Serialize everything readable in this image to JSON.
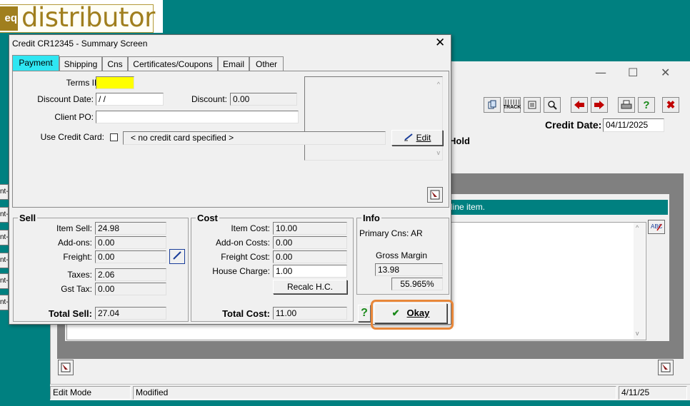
{
  "logo": {
    "badge": "eq",
    "text": "distributor"
  },
  "background_window": {
    "minimize": "—",
    "maximize": "☐",
    "close": "✕",
    "credit_date_label": "Credit Date:",
    "credit_date_value": "04/11/2025",
    "status_fragment": "Hold",
    "line_item_notice": "line item.",
    "status_bar": {
      "mode": "Edit Mode",
      "state": "Modified",
      "date": "4/11/25"
    },
    "toolbar_icons": [
      "copy-icon",
      "track-icon",
      "notes-icon",
      "search-icon",
      "back-arrow-icon",
      "forward-arrow-icon",
      "print-icon",
      "help-icon",
      "delete-icon"
    ],
    "toolbar_track_label": "TRACK",
    "left_stubs": [
      "nt-",
      "nt-",
      "nt-",
      "nt-",
      "nt-",
      "nt-"
    ]
  },
  "dialog": {
    "title": "Credit CR12345 - Summary Screen",
    "close": "✕",
    "tabs": [
      {
        "label": "Payment"
      },
      {
        "label": "Shipping"
      },
      {
        "label": "Cns"
      },
      {
        "label": "Certificates/Coupons"
      },
      {
        "label": "Email"
      },
      {
        "label": "Other"
      }
    ],
    "payment": {
      "terms_id_label": "Terms ID:",
      "terms_id_value": "",
      "discount_date_label": "Discount Date:",
      "discount_date_value": " /  /",
      "discount_label": "Discount:",
      "discount_value": "0.00",
      "client_po_label": "Client PO:",
      "client_po_value": "",
      "use_credit_card_label": "Use Credit Card:",
      "credit_card_value": "< no credit card specified >",
      "edit_label": "Edit"
    },
    "sell": {
      "title": "Sell",
      "item_sell_label": "Item Sell:",
      "item_sell": "24.98",
      "addons_label": "Add-ons:",
      "addons": "0.00",
      "freight_label": "Freight:",
      "freight": "0.00",
      "taxes_label": "Taxes:",
      "taxes": "2.06",
      "gst_label": "Gst Tax:",
      "gst": "0.00",
      "total_label": "Total Sell:",
      "total": "27.04"
    },
    "cost": {
      "title": "Cost",
      "item_cost_label": "Item Cost:",
      "item_cost": "10.00",
      "addon_costs_label": "Add-on Costs:",
      "addon_costs": "0.00",
      "freight_cost_label": "Freight Cost:",
      "freight_cost": "0.00",
      "house_charge_label": "House Charge:",
      "house_charge": "1.00",
      "recalc_label": "Recalc H.C.",
      "total_label": "Total Cost:",
      "total": "11.00"
    },
    "info": {
      "title": "Info",
      "primary_cns": "Primary Cns: AR",
      "gross_margin_label": "Gross Margin",
      "gross_margin": "13.98",
      "gross_margin_pct": "55.965%"
    },
    "help_label": "?",
    "okay_label": "Okay",
    "okay_check": "✔"
  },
  "colors": {
    "teal": "#008080",
    "active_tab": "#2fe6f2",
    "terms_highlight": "#ffff00",
    "okay_outline": "#e8873a"
  }
}
